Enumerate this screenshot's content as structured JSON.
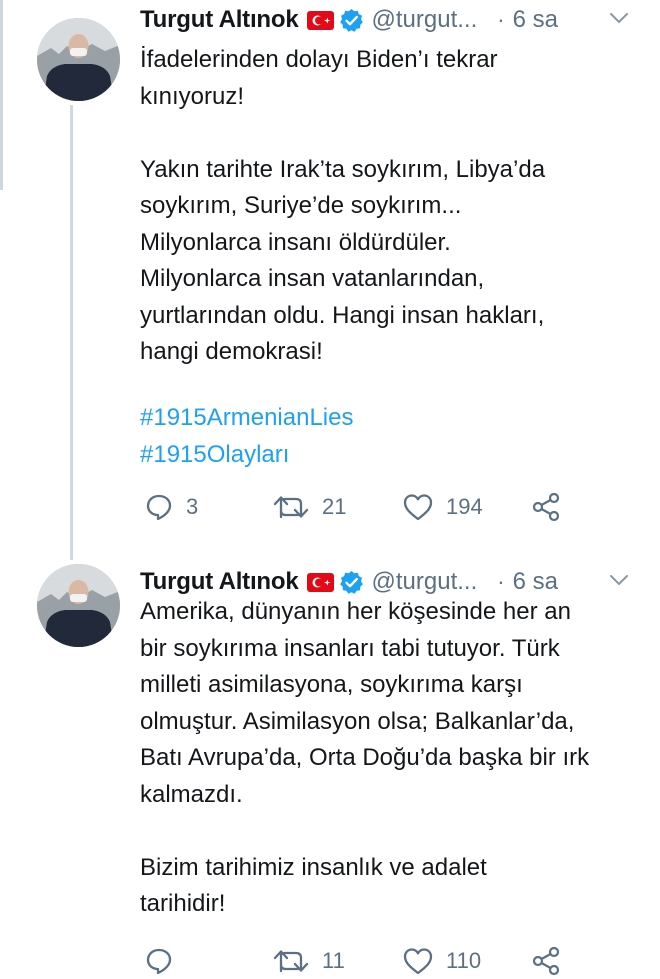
{
  "tweets": [
    {
      "name": "Turgut Altınok",
      "handle": "@turgut...",
      "dot": "·",
      "time": "6 sa",
      "text": "İfadelerinden dolayı Biden’ı tekrar\nkınıyoruz!\n\nYakın tarihte Irak’ta soykırım, Libya’da\nsoykırım, Suriye’de soykırım...\nMilyonlarca insanı öldürdüler.\nMilyonlarca insan vatanlarından,\nyurtlarından oldu. Hangi insan hakları,\nhangi demokrasi!",
      "hashtags": [
        "#1915ArmenianLies",
        "#1915Olayları"
      ],
      "replies": "3",
      "retweets": "21",
      "likes": "194"
    },
    {
      "name": "Turgut Altınok",
      "handle": "@turgut...",
      "dot": "·",
      "time": "6 sa",
      "text": "Amerika, dünyanın her köşesinde her an\nbir soykırıma insanları tabi tutuyor. Türk\nmilleti asimilasyona, soykırıma karşı\nolmuştur. Asimilasyon olsa; Balkanlar’da,\nBatı Avrupa’da, Orta Doğu’da başka bir ırk\nkalmazdı.\n\nBizim tarihimiz insanlık ve adalet\ntarihidir!",
      "replies": "",
      "retweets": "11",
      "likes": "110"
    }
  ],
  "icons": {
    "flag": "turkey-flag-icon",
    "verified": "verified-badge-icon",
    "chevron": "chevron-down-icon",
    "reply": "reply-icon",
    "retweet": "retweet-icon",
    "like": "heart-icon",
    "share": "share-icon"
  },
  "colors": {
    "text": "#14171a",
    "secondary": "#5b7083",
    "accent": "#1da1f2",
    "verified": "#1da1f2",
    "flag": "#e30a17"
  }
}
